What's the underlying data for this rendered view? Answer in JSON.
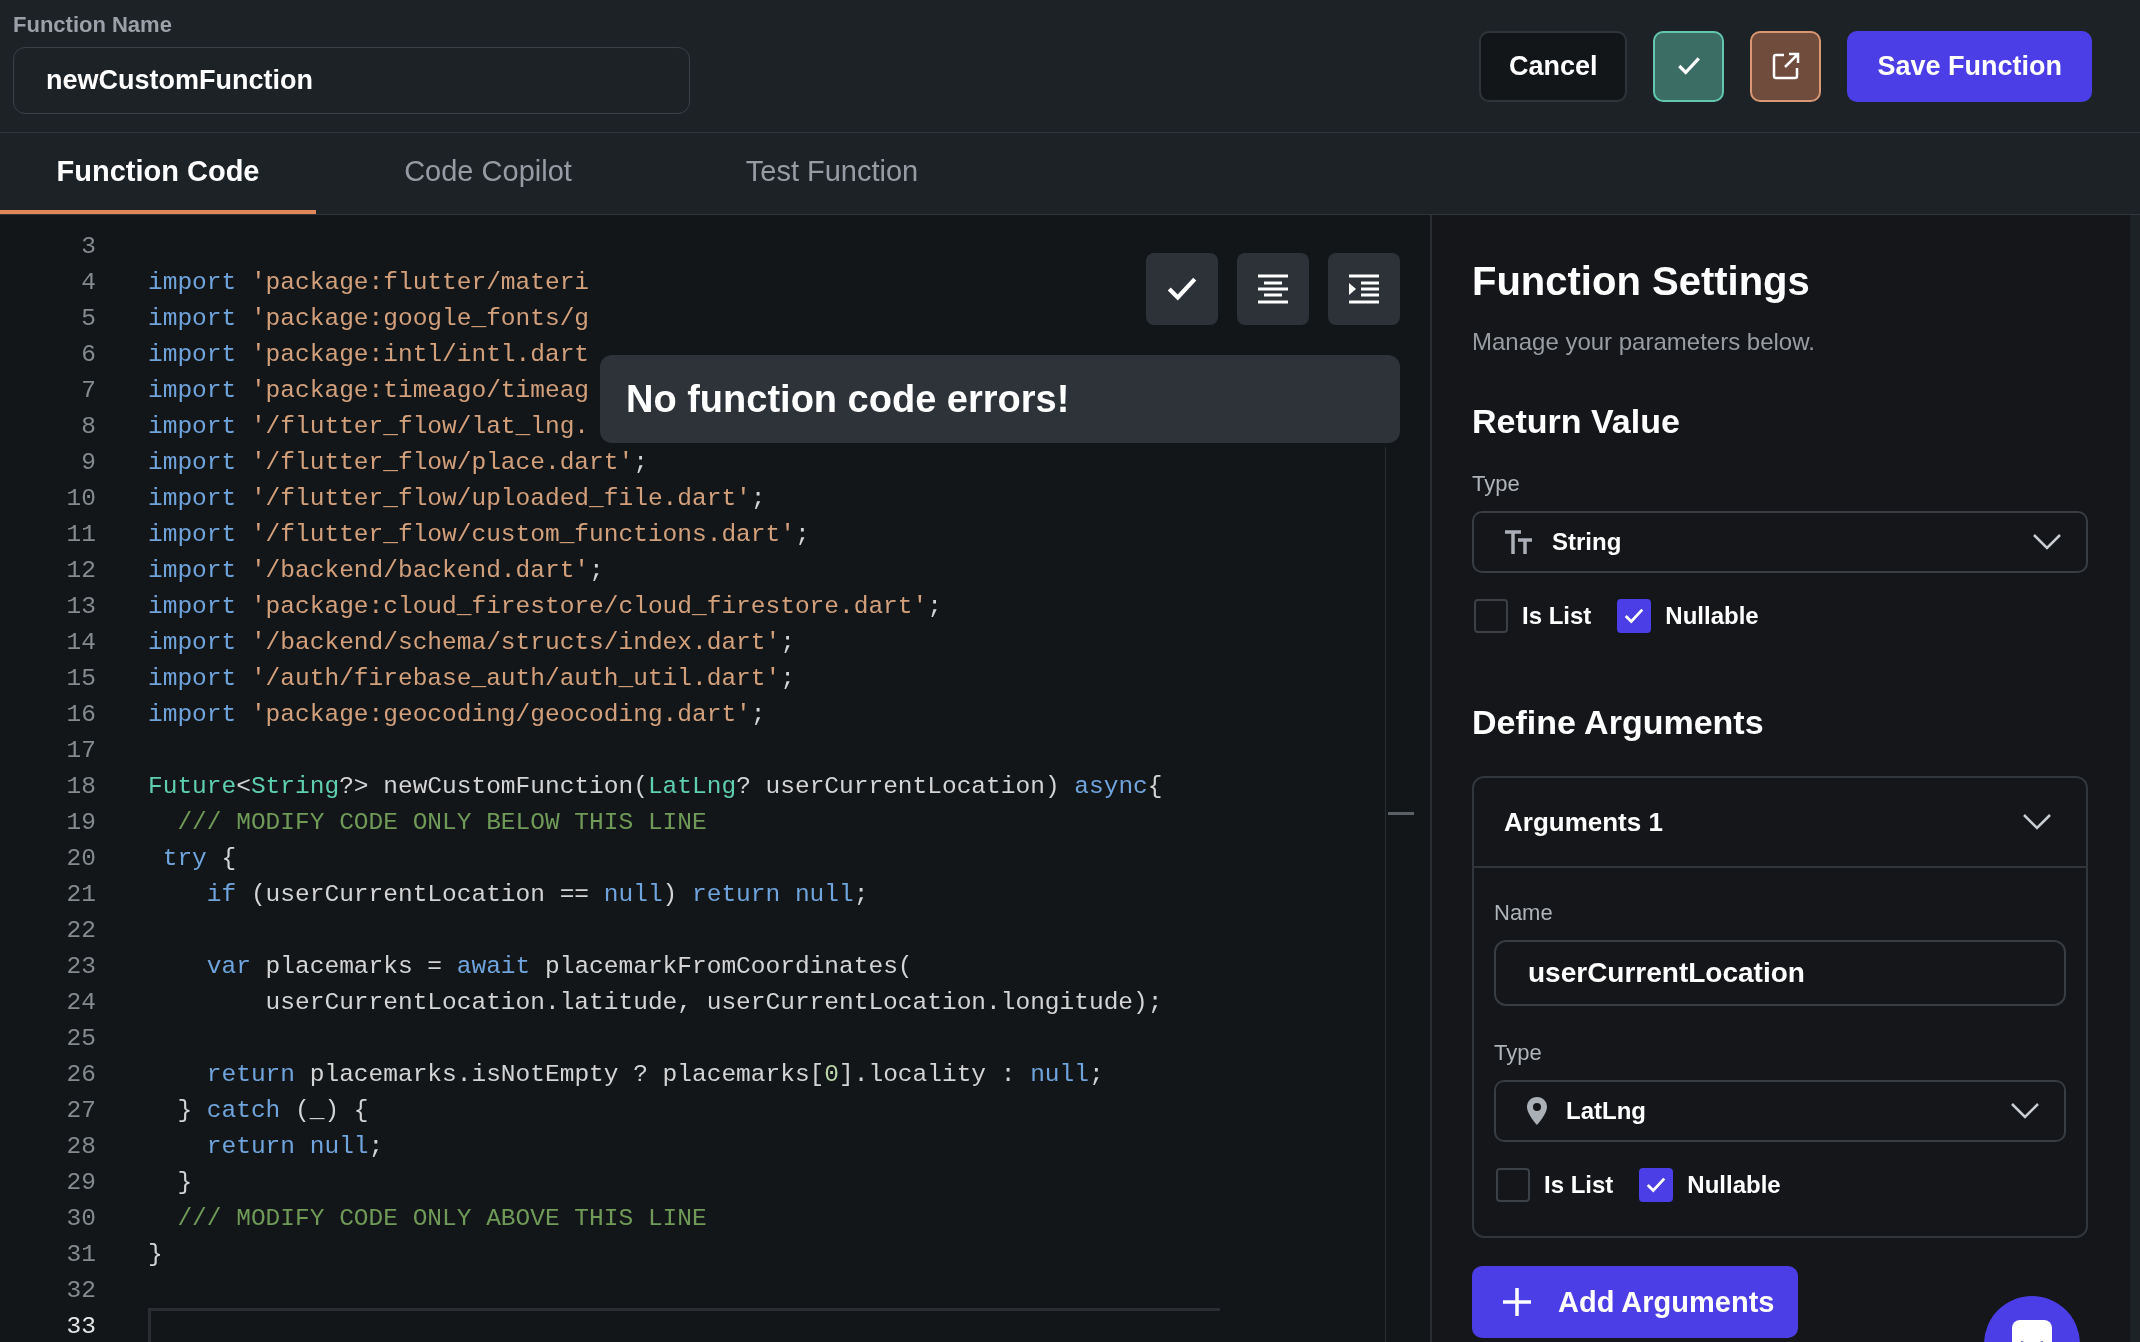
{
  "header": {
    "label": "Function Name",
    "value": "newCustomFunction",
    "buttons": {
      "cancel": "Cancel",
      "save": "Save Function"
    }
  },
  "tabs": [
    {
      "label": "Function Code",
      "selected": true
    },
    {
      "label": "Code Copilot",
      "selected": false
    },
    {
      "label": "Test Function",
      "selected": false
    }
  ],
  "editor": {
    "toast": "No function code errors!",
    "lines": [
      {
        "number": "3",
        "current": false
      },
      {
        "number": "4",
        "current": false,
        "segments": [
          {
            "kind": "kw",
            "text": "import"
          },
          {
            "kind": "str",
            "text": " 'package:flutter/materi"
          }
        ]
      },
      {
        "number": "5",
        "current": false,
        "segments": [
          {
            "kind": "kw",
            "text": "import"
          },
          {
            "kind": "str",
            "text": " 'package:google_fonts/g"
          }
        ]
      },
      {
        "number": "6",
        "current": false,
        "segments": [
          {
            "kind": "kw",
            "text": "import"
          },
          {
            "kind": "str",
            "text": " 'package:intl/intl.dart"
          }
        ]
      },
      {
        "number": "7",
        "current": false,
        "segments": [
          {
            "kind": "kw",
            "text": "import"
          },
          {
            "kind": "str",
            "text": " 'package:timeago/timeag"
          }
        ]
      },
      {
        "number": "8",
        "current": false,
        "segments": [
          {
            "kind": "kw",
            "text": "import"
          },
          {
            "kind": "str",
            "text": " '/flutter_flow/lat_lng."
          }
        ]
      },
      {
        "number": "9",
        "current": false,
        "segments": [
          {
            "kind": "kw",
            "text": "import"
          },
          {
            "kind": "str",
            "text": " '/flutter_flow/place.dart'"
          },
          {
            "kind": "plain",
            "text": ";"
          }
        ]
      },
      {
        "number": "10",
        "current": false,
        "segments": [
          {
            "kind": "kw",
            "text": "import"
          },
          {
            "kind": "str",
            "text": " '/flutter_flow/uploaded_file.dart'"
          },
          {
            "kind": "plain",
            "text": ";"
          }
        ]
      },
      {
        "number": "11",
        "current": false,
        "segments": [
          {
            "kind": "kw",
            "text": "import"
          },
          {
            "kind": "str",
            "text": " '/flutter_flow/custom_functions.dart'"
          },
          {
            "kind": "plain",
            "text": ";"
          }
        ]
      },
      {
        "number": "12",
        "current": false,
        "segments": [
          {
            "kind": "kw",
            "text": "import"
          },
          {
            "kind": "str",
            "text": " '/backend/backend.dart'"
          },
          {
            "kind": "plain",
            "text": ";"
          }
        ]
      },
      {
        "number": "13",
        "current": false,
        "segments": [
          {
            "kind": "kw",
            "text": "import"
          },
          {
            "kind": "str",
            "text": " 'package:cloud_firestore/cloud_firestore.dart'"
          },
          {
            "kind": "plain",
            "text": ";"
          }
        ]
      },
      {
        "number": "14",
        "current": false,
        "segments": [
          {
            "kind": "kw",
            "text": "import"
          },
          {
            "kind": "str",
            "text": " '/backend/schema/structs/index.dart'"
          },
          {
            "kind": "plain",
            "text": ";"
          }
        ]
      },
      {
        "number": "15",
        "current": false,
        "segments": [
          {
            "kind": "kw",
            "text": "import"
          },
          {
            "kind": "str",
            "text": " '/auth/firebase_auth/auth_util.dart'"
          },
          {
            "kind": "plain",
            "text": ";"
          }
        ]
      },
      {
        "number": "16",
        "current": false,
        "segments": [
          {
            "kind": "kw",
            "text": "import"
          },
          {
            "kind": "str",
            "text": " 'package:geocoding/geocoding.dart'"
          },
          {
            "kind": "plain",
            "text": ";"
          }
        ]
      },
      {
        "number": "17",
        "current": false
      },
      {
        "number": "18",
        "current": false,
        "segments": [
          {
            "kind": "type",
            "text": "Future"
          },
          {
            "kind": "plain",
            "text": "<"
          },
          {
            "kind": "type",
            "text": "String"
          },
          {
            "kind": "plain",
            "text": "?> newCustomFunction("
          },
          {
            "kind": "type",
            "text": "LatLng"
          },
          {
            "kind": "plain",
            "text": "? userCurrentLocation) "
          },
          {
            "kind": "kw",
            "text": "async"
          },
          {
            "kind": "plain",
            "text": "{"
          }
        ]
      },
      {
        "number": "19",
        "current": false,
        "segments": [
          {
            "kind": "cmt",
            "text": "  /// MODIFY CODE ONLY BELOW THIS LINE"
          }
        ]
      },
      {
        "number": "20",
        "current": false,
        "segments": [
          {
            "kind": "kw",
            "text": " try"
          },
          {
            "kind": "plain",
            "text": " {"
          }
        ]
      },
      {
        "number": "21",
        "current": false,
        "segments": [
          {
            "kind": "kw",
            "text": "    if"
          },
          {
            "kind": "plain",
            "text": " (userCurrentLocation == "
          },
          {
            "kind": "kw",
            "text": "null"
          },
          {
            "kind": "plain",
            "text": ") "
          },
          {
            "kind": "kw",
            "text": "return null"
          },
          {
            "kind": "plain",
            "text": ";"
          }
        ]
      },
      {
        "number": "22",
        "current": false
      },
      {
        "number": "23",
        "current": false,
        "segments": [
          {
            "kind": "kw",
            "text": "    var"
          },
          {
            "kind": "plain",
            "text": " placemarks = "
          },
          {
            "kind": "kw",
            "text": "await"
          },
          {
            "kind": "plain",
            "text": " placemarkFromCoordinates("
          }
        ]
      },
      {
        "number": "24",
        "current": false,
        "segments": [
          {
            "kind": "plain",
            "text": "        userCurrentLocation.latitude, userCurrentLocation.longitude);"
          }
        ]
      },
      {
        "number": "25",
        "current": false
      },
      {
        "number": "26",
        "current": false,
        "segments": [
          {
            "kind": "kw",
            "text": "    return"
          },
          {
            "kind": "plain",
            "text": " placemarks.isNotEmpty ? placemarks["
          },
          {
            "kind": "num",
            "text": "0"
          },
          {
            "kind": "plain",
            "text": "].locality : "
          },
          {
            "kind": "kw",
            "text": "null"
          },
          {
            "kind": "plain",
            "text": ";"
          }
        ]
      },
      {
        "number": "27",
        "current": false,
        "segments": [
          {
            "kind": "plain",
            "text": "  } "
          },
          {
            "kind": "kw",
            "text": "catch"
          },
          {
            "kind": "plain",
            "text": " (_) {"
          }
        ]
      },
      {
        "number": "28",
        "current": false,
        "segments": [
          {
            "kind": "kw",
            "text": "    return null"
          },
          {
            "kind": "plain",
            "text": ";"
          }
        ]
      },
      {
        "number": "29",
        "current": false,
        "segments": [
          {
            "kind": "plain",
            "text": "  }"
          }
        ]
      },
      {
        "number": "30",
        "current": false,
        "segments": [
          {
            "kind": "cmt",
            "text": "  /// MODIFY CODE ONLY ABOVE THIS LINE"
          }
        ]
      },
      {
        "number": "31",
        "current": false,
        "segments": [
          {
            "kind": "plain",
            "text": "}"
          }
        ]
      },
      {
        "number": "32",
        "current": false
      },
      {
        "number": "33",
        "current": true
      }
    ]
  },
  "settings": {
    "title": "Function Settings",
    "subtitle": "Manage your parameters below.",
    "return_value": {
      "heading": "Return Value",
      "type_label": "Type",
      "type": {
        "kind": "text",
        "value": "String"
      },
      "is_list": {
        "label": "Is List",
        "checked": false
      },
      "nullable": {
        "label": "Nullable",
        "checked": true
      }
    },
    "arguments_heading": "Define Arguments",
    "arguments": [
      {
        "title": "Arguments 1",
        "expanded": true,
        "name_label": "Name",
        "name": "userCurrentLocation",
        "type_label": "Type",
        "type": {
          "kind": "location",
          "value": "LatLng"
        },
        "is_list": {
          "label": "Is List",
          "checked": false
        },
        "nullable": {
          "label": "Nullable",
          "checked": true
        }
      }
    ],
    "add_button": "Add Arguments"
  }
}
